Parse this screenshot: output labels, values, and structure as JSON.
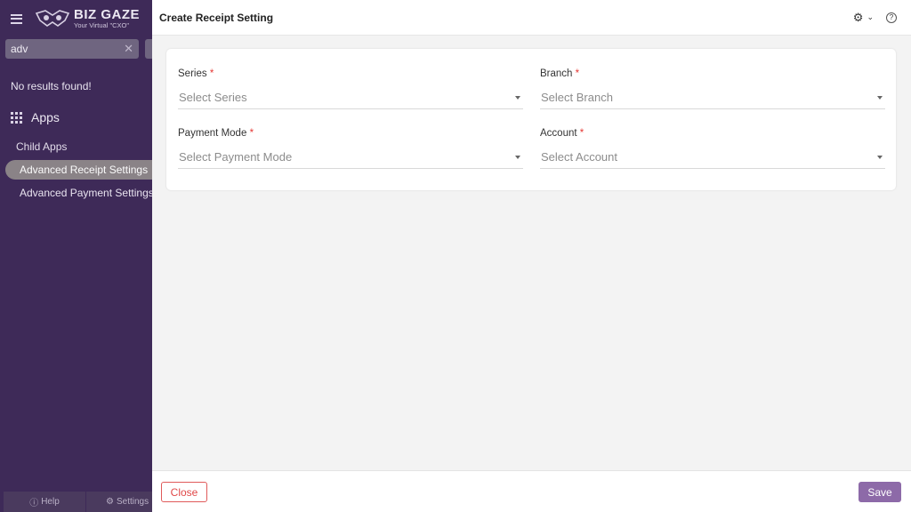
{
  "sidebar": {
    "logo": {
      "title": "BIZ GAZE",
      "tagline": "Your Virtual \"CXO\""
    },
    "search": {
      "value": "adv",
      "clear_icon": "close-icon"
    },
    "no_results": "No results found!",
    "apps_heading": "Apps",
    "child_apps_label": "Child Apps",
    "items": [
      {
        "label": "Advanced Receipt Settings",
        "active": true
      },
      {
        "label": "Advanced Payment Settings",
        "active": false
      }
    ],
    "footer": {
      "help_label": "Help",
      "settings_label": "Settings"
    }
  },
  "main": {
    "title": "Create Receipt Setting",
    "form": {
      "series": {
        "label": "Series",
        "required_mark": "*",
        "placeholder": "Select Series"
      },
      "branch": {
        "label": "Branch",
        "required_mark": "*",
        "placeholder": "Select Branch"
      },
      "payment_mode": {
        "label": "Payment Mode",
        "required_mark": "*",
        "placeholder": "Select Payment Mode"
      },
      "account": {
        "label": "Account",
        "required_mark": "*",
        "placeholder": "Select Account"
      }
    },
    "footer": {
      "close_label": "Close",
      "save_label": "Save"
    }
  },
  "colors": {
    "sidebar_bg": "#3e2a58",
    "active_item_bg": "#8a8387",
    "save_button": "#8d6aa8",
    "close_button_border": "#e05a5a",
    "required_mark": "#e53935"
  }
}
